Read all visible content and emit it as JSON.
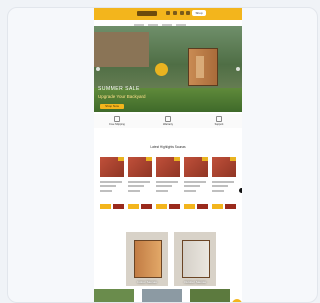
{
  "colors": {
    "accent": "#f3b51c",
    "brand_dark": "#9a2a1c"
  },
  "header": {
    "shop_label": "Shop"
  },
  "hero": {
    "title": "SUMMER SALE",
    "subtitle": "Upgrade Your Backyard",
    "cta_label": "Shop Now"
  },
  "features": [
    {
      "icon": "truck-icon",
      "label": "Free Shipping"
    },
    {
      "icon": "warranty-icon",
      "label": "Warranty"
    },
    {
      "icon": "support-icon",
      "label": "Support"
    }
  ],
  "section": {
    "title": "Latest Highlights Saunas"
  },
  "products": [
    {
      "name": "Sauna"
    },
    {
      "name": "Sauna"
    },
    {
      "name": "Sauna"
    },
    {
      "name": "Sauna"
    },
    {
      "name": "Sauna"
    }
  ],
  "categories": [
    {
      "label": "Indoor Saunas"
    },
    {
      "label": "Outdoor Saunas"
    }
  ]
}
